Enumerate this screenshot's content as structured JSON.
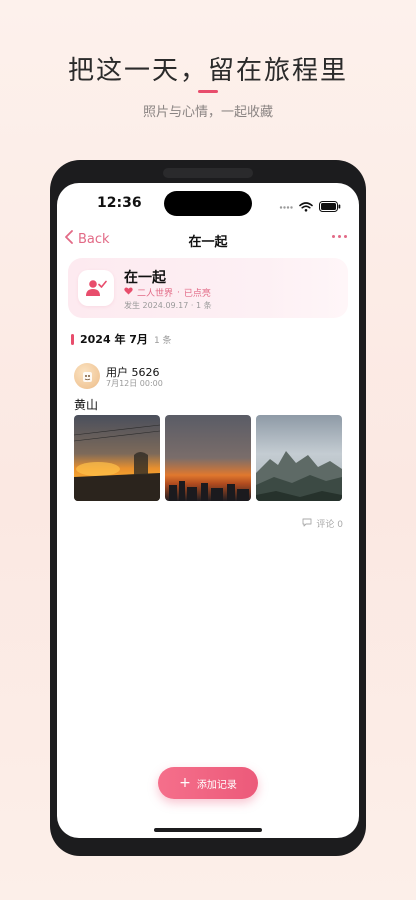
{
  "promo": {
    "title": "把这一天，留在旅程里",
    "subtitle": "照片与心情，一起收藏"
  },
  "status_bar": {
    "time": "12:36",
    "icons": [
      "signal-icon",
      "wifi-icon",
      "battery-icon"
    ]
  },
  "nav": {
    "back_label": "Back",
    "title": "在一起",
    "more_icon": "more-dots-icon"
  },
  "card": {
    "icon": "user-check-icon",
    "title": "在一起",
    "tag_world": "二人世界",
    "tag_separator": "·",
    "tag_status": "已点亮",
    "meta": "发生 2024.09.17 · 1 条"
  },
  "section": {
    "label": "2024 年 7月",
    "count": "1 条"
  },
  "post": {
    "user": "用户 5626",
    "time": "7月12日 00:00",
    "text": "黄山",
    "photos": [
      "sunset-photo",
      "dusk-city-photo",
      "mountain-photo"
    ],
    "comment_label": "评论 0"
  },
  "fab": {
    "label": "添加记录"
  },
  "colors": {
    "accent": "#e84d6c",
    "link": "#e26a86",
    "background": "#fdf1ec"
  }
}
